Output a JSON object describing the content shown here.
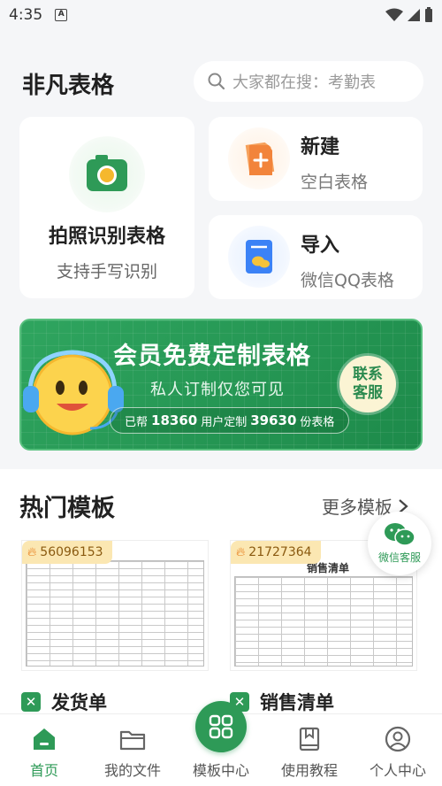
{
  "status_bar": {
    "time": "4:35",
    "notif_icon": "a-icon"
  },
  "header": {
    "title": "非凡表格",
    "search_placeholder": "大家都在搜：考勤表"
  },
  "quick_actions": {
    "photo": {
      "title": "拍照识别表格",
      "subtitle": "支持手写识别",
      "icon": "camera-icon"
    },
    "new": {
      "title": "新建",
      "subtitle": "空白表格",
      "icon": "add-doc-icon"
    },
    "import": {
      "title": "导入",
      "subtitle": "微信QQ表格",
      "icon": "import-doc-icon"
    }
  },
  "banner": {
    "title": "会员免费定制表格",
    "subtitle": "私人订制仅您可见",
    "stats_prefix": "已帮",
    "users_count": "18360",
    "users_suffix": "用户定制",
    "sheets_count": "39630",
    "sheets_suffix": "份表格",
    "contact_line1": "联系",
    "contact_line2": "客服"
  },
  "templates_section": {
    "title": "热门模板",
    "more": "更多模板",
    "items": [
      {
        "name": "发货单",
        "count": "56096153"
      },
      {
        "name": "销售清单",
        "count": "21727364",
        "sheet_title": "销售清单"
      }
    ]
  },
  "float_service": {
    "label": "微信客服"
  },
  "tabbar": [
    {
      "label": "首页",
      "active": true
    },
    {
      "label": "我的文件"
    },
    {
      "label": "模板中心"
    },
    {
      "label": "使用教程"
    },
    {
      "label": "个人中心"
    }
  ],
  "colors": {
    "accent": "#2e9a57",
    "badge": "#fbe7b2",
    "banner": "#2fa55f"
  }
}
